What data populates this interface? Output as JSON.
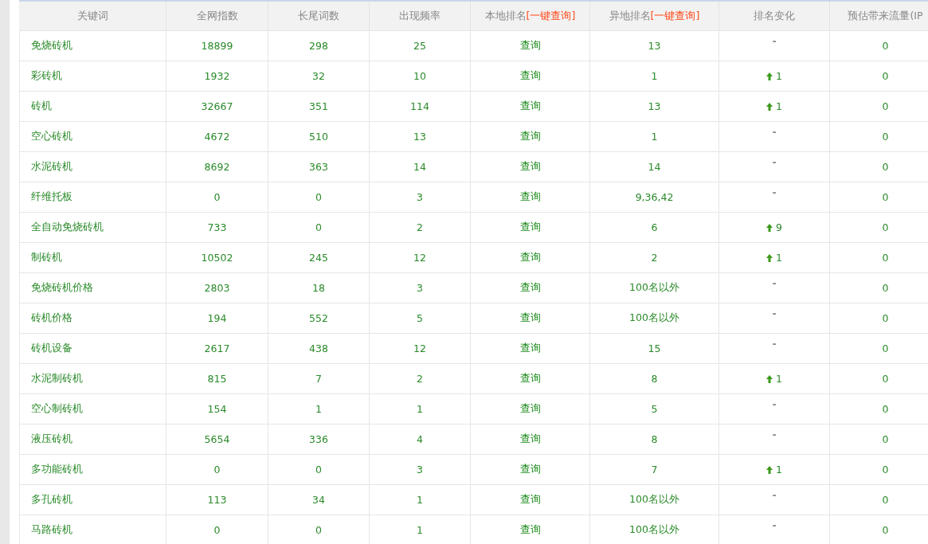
{
  "columns": [
    {
      "label": "关键词"
    },
    {
      "label": "全网指数"
    },
    {
      "label": "长尾词数"
    },
    {
      "label": "出现频率"
    },
    {
      "label": "本地排名",
      "link": "[一键查询]"
    },
    {
      "label": "异地排名",
      "link": "[一键查询]"
    },
    {
      "label": "排名变化"
    },
    {
      "label": "预估带来流量(IP"
    }
  ],
  "rows": [
    {
      "keyword": "免烧砖机",
      "index": "18899",
      "longtail": "298",
      "freq": "25",
      "local": "查询",
      "remote": "13",
      "change": {
        "kind": "none",
        "text": "-"
      },
      "traffic": "0"
    },
    {
      "keyword": "彩砖机",
      "index": "1932",
      "longtail": "32",
      "freq": "10",
      "local": "查询",
      "remote": "1",
      "change": {
        "kind": "up",
        "text": "1"
      },
      "traffic": "0"
    },
    {
      "keyword": "砖机",
      "index": "32667",
      "longtail": "351",
      "freq": "114",
      "local": "查询",
      "remote": "13",
      "change": {
        "kind": "up",
        "text": "1"
      },
      "traffic": "0"
    },
    {
      "keyword": "空心砖机",
      "index": "4672",
      "longtail": "510",
      "freq": "13",
      "local": "查询",
      "remote": "1",
      "change": {
        "kind": "none",
        "text": "-"
      },
      "traffic": "0"
    },
    {
      "keyword": "水泥砖机",
      "index": "8692",
      "longtail": "363",
      "freq": "14",
      "local": "查询",
      "remote": "14",
      "change": {
        "kind": "none",
        "text": "-"
      },
      "traffic": "0"
    },
    {
      "keyword": "纤维托板",
      "index": "0",
      "longtail": "0",
      "freq": "3",
      "local": "查询",
      "remote": "9,36,42",
      "change": {
        "kind": "none",
        "text": "-"
      },
      "traffic": "0"
    },
    {
      "keyword": "全自动免烧砖机",
      "index": "733",
      "longtail": "0",
      "freq": "2",
      "local": "查询",
      "remote": "6",
      "change": {
        "kind": "up",
        "text": "9"
      },
      "traffic": "0"
    },
    {
      "keyword": "制砖机",
      "index": "10502",
      "longtail": "245",
      "freq": "12",
      "local": "查询",
      "remote": "2",
      "change": {
        "kind": "up",
        "text": "1"
      },
      "traffic": "0"
    },
    {
      "keyword": "免烧砖机价格",
      "index": "2803",
      "longtail": "18",
      "freq": "3",
      "local": "查询",
      "remote": "100名以外",
      "change": {
        "kind": "none",
        "text": "-"
      },
      "traffic": "0"
    },
    {
      "keyword": "砖机价格",
      "index": "194",
      "longtail": "552",
      "freq": "5",
      "local": "查询",
      "remote": "100名以外",
      "change": {
        "kind": "none",
        "text": "-"
      },
      "traffic": "0"
    },
    {
      "keyword": "砖机设备",
      "index": "2617",
      "longtail": "438",
      "freq": "12",
      "local": "查询",
      "remote": "15",
      "change": {
        "kind": "none",
        "text": "-"
      },
      "traffic": "0"
    },
    {
      "keyword": "水泥制砖机",
      "index": "815",
      "longtail": "7",
      "freq": "2",
      "local": "查询",
      "remote": "8",
      "change": {
        "kind": "up",
        "text": "1"
      },
      "traffic": "0"
    },
    {
      "keyword": "空心制砖机",
      "index": "154",
      "longtail": "1",
      "freq": "1",
      "local": "查询",
      "remote": "5",
      "change": {
        "kind": "none",
        "text": "-"
      },
      "traffic": "0"
    },
    {
      "keyword": "液压砖机",
      "index": "5654",
      "longtail": "336",
      "freq": "4",
      "local": "查询",
      "remote": "8",
      "change": {
        "kind": "none",
        "text": "-"
      },
      "traffic": "0"
    },
    {
      "keyword": "多功能砖机",
      "index": "0",
      "longtail": "0",
      "freq": "3",
      "local": "查询",
      "remote": "7",
      "change": {
        "kind": "up",
        "text": "1"
      },
      "traffic": "0"
    },
    {
      "keyword": "多孔砖机",
      "index": "113",
      "longtail": "34",
      "freq": "1",
      "local": "查询",
      "remote": "100名以外",
      "change": {
        "kind": "none",
        "text": "-"
      },
      "traffic": "0"
    },
    {
      "keyword": "马路砖机",
      "index": "0",
      "longtail": "0",
      "freq": "1",
      "local": "查询",
      "remote": "100名以外",
      "change": {
        "kind": "none",
        "text": "-"
      },
      "traffic": "0"
    }
  ]
}
